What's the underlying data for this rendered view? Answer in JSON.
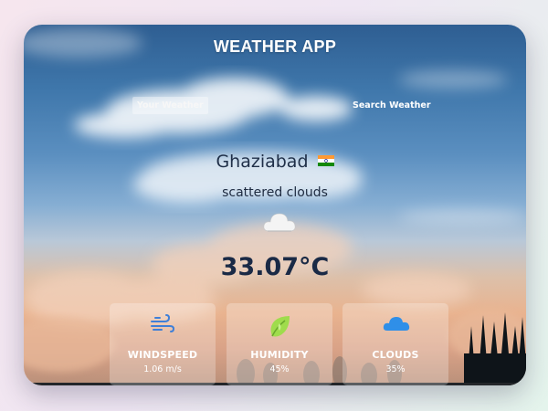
{
  "app": {
    "title": "WEATHER APP"
  },
  "tabs": [
    {
      "label": "Your Weather",
      "active": true
    },
    {
      "label": "Search Weather",
      "active": false
    }
  ],
  "weather": {
    "city": "Ghaziabad",
    "country_flag_icon": "india-flag-icon",
    "description": "scattered clouds",
    "condition_icon": "cloud-icon",
    "temperature": "33.07°C"
  },
  "metrics": [
    {
      "icon": "wind-icon",
      "title": "WINDSPEED",
      "value": "1.06 m/s",
      "color": "#3f7fd8"
    },
    {
      "icon": "humidity-leaf-icon",
      "title": "HUMIDITY",
      "value": "45%",
      "color": "#9fdc4c"
    },
    {
      "icon": "cloud-icon",
      "title": "CLOUDS",
      "value": "35%",
      "color": "#2f8fe8"
    }
  ],
  "colors": {
    "text_dark": "#1f2f48",
    "text_light": "#ffffff"
  }
}
